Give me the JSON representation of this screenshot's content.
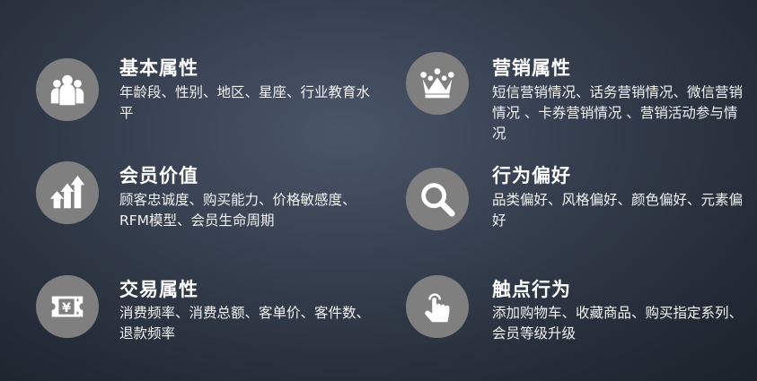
{
  "colors": {
    "icon_bg": "#7f7f7f",
    "text": "#ffffff"
  },
  "features": [
    {
      "icon": "people-icon",
      "title": "基本属性",
      "desc": "年龄段、性别、地区、星座、行业教育水平"
    },
    {
      "icon": "growth-arrows-icon",
      "title": "会员价值",
      "desc": "顾客忠诚度、购买能力、价格敏感度、RFM模型、会员生命周期"
    },
    {
      "icon": "ticket-icon",
      "title": "交易属性",
      "desc": "消费频率、消费总额、客单价、客件数、退款频率"
    },
    {
      "icon": "crown-icon",
      "title": "营销属性",
      "desc": "短信营销情况、话务营销情况、微信营销情况 、卡券营销情况 、营销活动参与情况"
    },
    {
      "icon": "search-icon",
      "title": "行为偏好",
      "desc": "品类偏好、风格偏好、颜色偏好、元素偏好"
    },
    {
      "icon": "touch-hand-icon",
      "title": "触点行为",
      "desc": "添加购物车、收藏商品、购买指定系列、会员等级升级"
    }
  ]
}
